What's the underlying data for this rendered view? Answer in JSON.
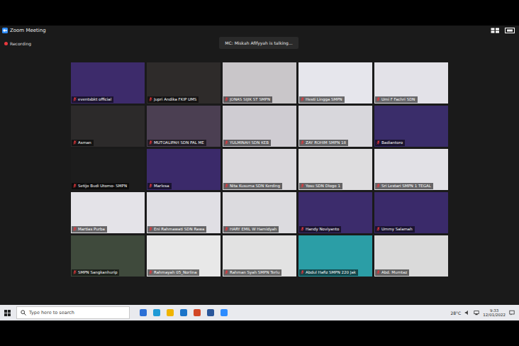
{
  "window": {
    "title": "Zoom Meeting"
  },
  "recording": {
    "label": "Recording"
  },
  "speaker_banner": {
    "text": "MC: Miskah Afifyyah is talking..."
  },
  "tiles": [
    {
      "name": "eventsbkt official",
      "muted": true,
      "color": "#3d2b6b"
    },
    {
      "name": "Jupri Andika FKIP UMS",
      "muted": true,
      "color": "#2e2b2a"
    },
    {
      "name": "JONAS SIJIK ST SMPN",
      "muted": true,
      "color": "#c9c6c9"
    },
    {
      "name": "Hesti Lingga SMPN",
      "muted": true,
      "color": "#e6e6ec"
    },
    {
      "name": "Umi F Fachri SDN",
      "muted": true,
      "color": "#e3e2e8"
    },
    {
      "name": "Asman",
      "muted": true,
      "color": "#2c2a2a"
    },
    {
      "name": "MUTOALIPAH SDN PAL ME",
      "muted": true,
      "color": "#4b3f52"
    },
    {
      "name": "YULMINAH SDN KEB",
      "muted": true,
      "color": "#cfccd2"
    },
    {
      "name": "ZAY ROHIM SMPN 18",
      "muted": true,
      "color": "#d8d7dc"
    },
    {
      "name": "Badiantoro",
      "muted": true,
      "color": "#3a2d6a"
    },
    {
      "name": "Setijo Budi Utomo- SMPN",
      "muted": true,
      "color": "#1c1c1c"
    },
    {
      "name": "Marlesa",
      "muted": true,
      "color": "#3b2a6a"
    },
    {
      "name": "Nita Kusuma SDN Kerding",
      "muted": true,
      "color": "#dad8dc"
    },
    {
      "name": "Yosu SDN Dlogo 1",
      "muted": true,
      "color": "#dedddf"
    },
    {
      "name": "Sri Lestari SMPN 1 TEGAL",
      "muted": true,
      "color": "#e2e1e6"
    },
    {
      "name": "Martias Purba",
      "muted": true,
      "color": "#e4e3e8"
    },
    {
      "name": "Eni Rahmawati SDN Rawa",
      "muted": true,
      "color": "#e0dfe4"
    },
    {
      "name": "HARY EMIL W Hamidyah",
      "muted": true,
      "color": "#dcdbdf"
    },
    {
      "name": "Handy Noviyanto",
      "muted": true,
      "color": "#3c2c6c"
    },
    {
      "name": "Ummy Salamah",
      "muted": true,
      "color": "#3a2a6a"
    },
    {
      "name": "SMPN Sangkanhurip",
      "muted": true,
      "color": "#3f4a3c"
    },
    {
      "name": "Rahmayah 05_Norlina",
      "muted": true,
      "color": "#e8e8e8"
    },
    {
      "name": "Rahman Syah SMPN Terlu",
      "muted": true,
      "color": "#e2e2e2"
    },
    {
      "name": "Abdul Hafiz SMPN 220 Jak",
      "muted": true,
      "color": "#2b9ea6"
    },
    {
      "name": "Abd. Mumtaz",
      "muted": true,
      "color": "#dadada"
    }
  ],
  "taskbar": {
    "search_placeholder": "Type here to search",
    "temperature": "28°C",
    "time": "9:33",
    "date": "12/01/2022"
  }
}
